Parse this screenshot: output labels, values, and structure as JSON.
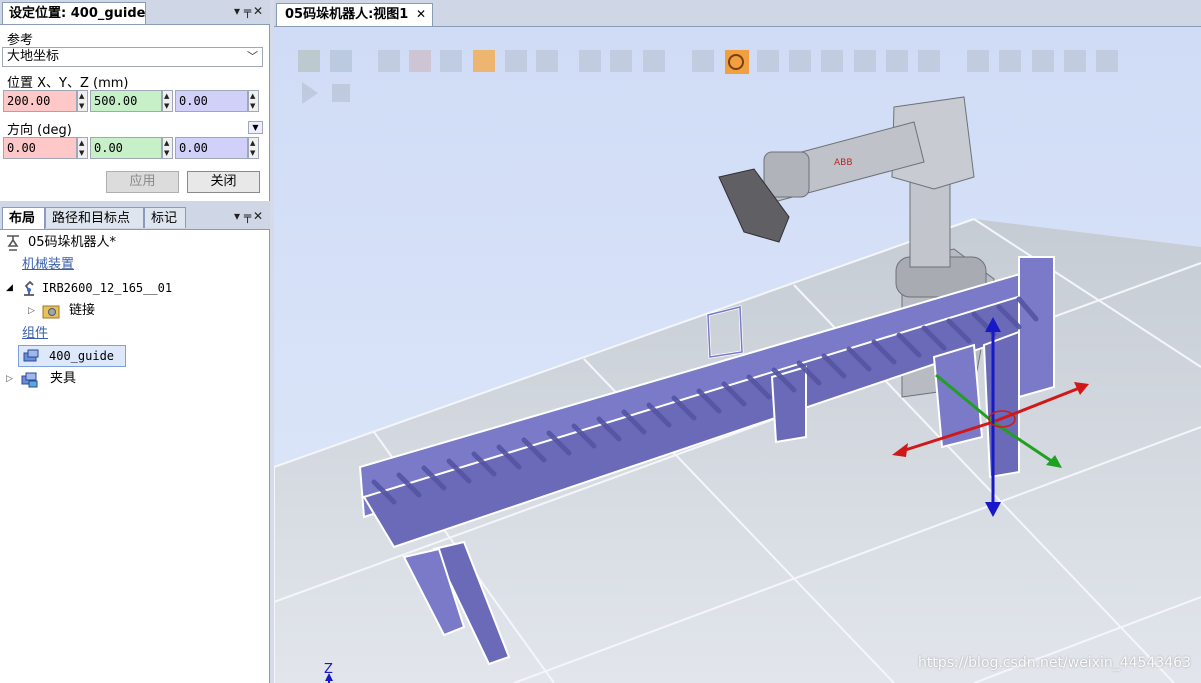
{
  "position_panel": {
    "title": "设定位置: 400_guide",
    "reference_label": "参考",
    "reference_value": "大地坐标",
    "position_label": "位置 X、Y、Z (mm)",
    "x": "200.00",
    "y": "500.00",
    "z": "0.00",
    "orientation_label": "方向 (deg)",
    "rx": "0.00",
    "ry": "0.00",
    "rz": "0.00",
    "apply_label": "应用",
    "close_label": "关闭"
  },
  "layout_panel": {
    "tabs": [
      "布局",
      "路径和目标点",
      "标记"
    ],
    "station": "05码垛机器人*",
    "mechanisms_section": "机械装置",
    "robot": "IRB2600_12_165__01",
    "links": "链接",
    "components_section": "组件",
    "selected_component": "400_guide",
    "fixture": "夹具"
  },
  "view": {
    "tab_title": "05码垛机器人:视图1",
    "axis_label": "Z",
    "watermark": "https://blog.csdn.net/weixin_44543463"
  },
  "colors": {
    "x_field": "#ffc8c8",
    "y_field": "#c8f0c8",
    "z_field": "#d0d0f8",
    "conveyor": "#7a7ac8",
    "axis_x": "#d01818",
    "axis_y": "#20a020",
    "axis_z": "#1818c8"
  },
  "icons": {
    "pin": "pin-icon",
    "close": "close-icon"
  }
}
